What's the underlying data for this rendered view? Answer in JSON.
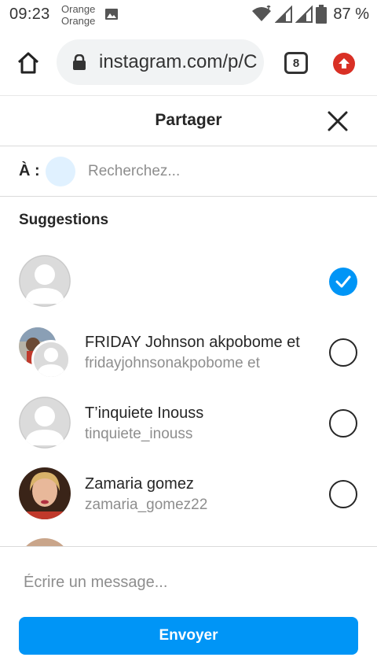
{
  "status_bar": {
    "time": "09:23",
    "carrier_line1": "Orange",
    "carrier_line2": "Orange",
    "battery": "87 %",
    "icons": [
      "gallery-icon",
      "wifi-icon",
      "signal-icon",
      "signal-icon",
      "battery-icon"
    ]
  },
  "browser": {
    "url": "instagram.com/p/C",
    "tab_count": "8",
    "icons": [
      "home-icon",
      "lock-icon",
      "tabs-icon",
      "upload-arrow-icon"
    ]
  },
  "sheet": {
    "title": "Partager",
    "to_label": "À :",
    "search_placeholder": "Recherchez...",
    "suggestions_title": "Suggestions"
  },
  "suggestions": [
    {
      "full_name": "",
      "username": "",
      "selected": true
    },
    {
      "full_name": "FRIDAY Johnson akpobome et",
      "username": "fridayjohnsonakpobome et",
      "selected": false
    },
    {
      "full_name": "T’inquiete Inouss",
      "username": "tinquiete_inouss",
      "selected": false
    },
    {
      "full_name": "Zamaria gomez",
      "username": "zamaria_gomez22",
      "selected": false
    }
  ],
  "composer": {
    "message_placeholder": "Écrire un message...",
    "send_label": "Envoyer"
  },
  "colors": {
    "accent": "#0095f6",
    "chip": "#e0f1ff",
    "extension_red": "#d93025"
  }
}
